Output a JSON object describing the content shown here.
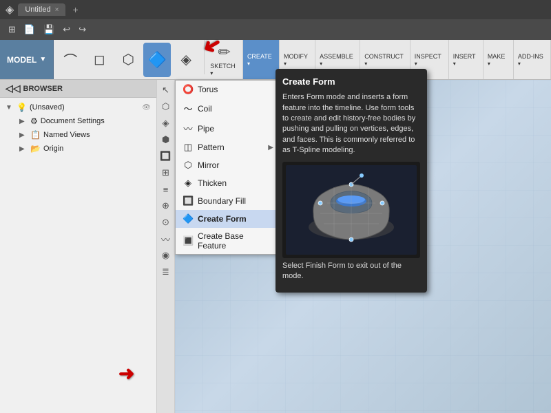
{
  "title_bar": {
    "app_icon": "◈",
    "tab_label": "Untitled",
    "close_label": "×",
    "new_tab_label": "+"
  },
  "quick_access": {
    "grid_icon": "⊞",
    "file_icon": "📄",
    "save_icon": "💾",
    "undo_icon": "↩",
    "redo_icon": "↪"
  },
  "main_toolbar": {
    "model_label": "MODEL",
    "model_arrow": "▼",
    "sections": [
      {
        "id": "sketch",
        "label": "SKETCH",
        "arrow": "▾",
        "icon": "✏"
      },
      {
        "id": "create",
        "label": "CREATE",
        "arrow": "▾",
        "icon": "🔷"
      },
      {
        "id": "modify",
        "label": "MODIFY",
        "arrow": "▾",
        "icon": "🔧"
      },
      {
        "id": "assemble",
        "label": "ASSEMBLE",
        "arrow": "▾",
        "icon": "🔩"
      },
      {
        "id": "construct",
        "label": "CONSTRUCT",
        "arrow": "▾",
        "icon": "📐"
      },
      {
        "id": "inspect",
        "label": "INSPECT",
        "arrow": "▾",
        "icon": "🔍"
      },
      {
        "id": "insert",
        "label": "INSERT",
        "arrow": "▾",
        "icon": "⬇"
      },
      {
        "id": "make",
        "label": "MAKE",
        "arrow": "▾",
        "icon": "🏭"
      },
      {
        "id": "add_ins",
        "label": "ADD-INS",
        "arrow": "▾",
        "icon": "🔌"
      }
    ]
  },
  "browser": {
    "header": "BROWSER",
    "items": [
      {
        "id": "unsaved",
        "label": "(Unsaved)",
        "icon": "📁",
        "indent": 0,
        "expandable": true,
        "expanded": true,
        "has_eye": true,
        "has_settings": true
      },
      {
        "id": "doc_settings",
        "label": "Document Settings",
        "icon": "⚙",
        "indent": 1,
        "expandable": true,
        "expanded": false
      },
      {
        "id": "named_views",
        "label": "Named Views",
        "icon": "📋",
        "indent": 1,
        "expandable": true,
        "expanded": false
      },
      {
        "id": "origin",
        "label": "Origin",
        "icon": "📂",
        "indent": 1,
        "expandable": true,
        "expanded": false
      }
    ]
  },
  "create_dropdown": {
    "items": [
      {
        "id": "torus",
        "label": "Torus",
        "icon": "⭕"
      },
      {
        "id": "coil",
        "label": "Coil",
        "icon": "🌀"
      },
      {
        "id": "pipe",
        "label": "Pipe",
        "icon": "〰"
      },
      {
        "id": "pattern",
        "label": "Pattern",
        "icon": "◫",
        "has_arrow": true
      },
      {
        "id": "mirror",
        "label": "Mirror",
        "icon": "⬡"
      },
      {
        "id": "thicken",
        "label": "Thicken",
        "icon": "◈"
      },
      {
        "id": "boundary_fill",
        "label": "Boundary Fill",
        "icon": "🔲"
      },
      {
        "id": "create_form",
        "label": "Create Form",
        "icon": "🔷",
        "highlighted": true
      },
      {
        "id": "create_base",
        "label": "Create Base Feature",
        "icon": "🔳"
      }
    ]
  },
  "tooltip": {
    "title": "Create Form",
    "description": "Enters Form mode and inserts a form feature into the timeline. Use form tools to create and edit history-free bodies by pushing and pulling on vertices, edges, and faces. This is commonly referred to as T-Spline modeling.",
    "finish_note": "Select Finish Form to exit out of the mode."
  },
  "vert_toolbar": {
    "icons": [
      "↖",
      "⬡",
      "◈",
      "⬢",
      "🔲",
      "⊞",
      "≡",
      "⊕",
      "⊙",
      "〰",
      "◉",
      "≣"
    ]
  }
}
